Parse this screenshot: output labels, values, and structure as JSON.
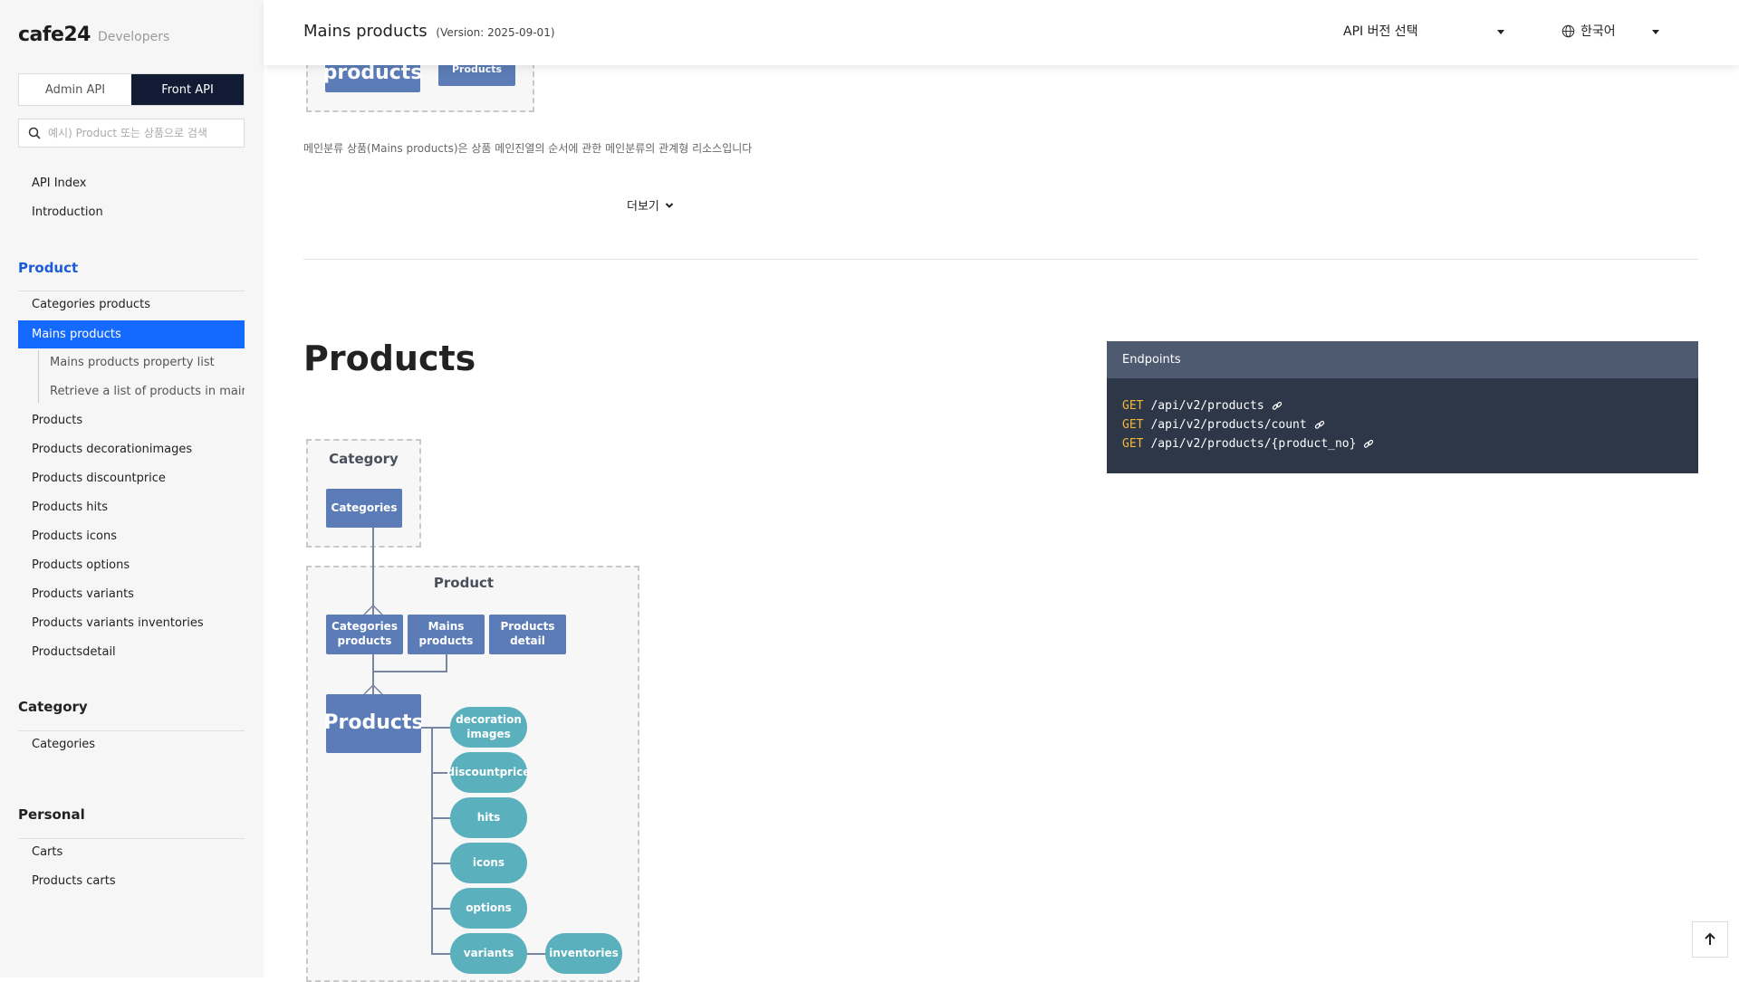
{
  "logo": {
    "brand": "cafe24",
    "sub": "Developers"
  },
  "api_tabs": [
    {
      "label": "Admin API",
      "active": false
    },
    {
      "label": "Front API",
      "active": true
    }
  ],
  "search": {
    "placeholder": "예시) Product 또는 상품으로 검색",
    "value": ""
  },
  "nav": {
    "top_links": [
      "API Index",
      "Introduction"
    ],
    "sections": [
      {
        "title": "Product",
        "items": [
          "Categories products",
          "Mains products",
          "Products",
          "Products decorationimages",
          "Products discountprice",
          "Products hits",
          "Products icons",
          "Products options",
          "Products variants",
          "Products variants inventories",
          "Productsdetail"
        ],
        "active_index": 1,
        "sub_items": [
          "Mains products property list",
          "Retrieve a list of products in main category"
        ]
      },
      {
        "title": "Category",
        "items": [
          "Categories"
        ]
      },
      {
        "title": "Personal",
        "items": [
          "Carts",
          "Products carts"
        ]
      }
    ]
  },
  "header": {
    "title": "Mains products",
    "version": "(Version: 2025-09-01)",
    "version_select": "API 버전 선택",
    "language": "한국어"
  },
  "main": {
    "description": "메인분류 상품(Mains products)은 상품 메인진열의 순서에 관한 메인분류의 관계형 리소스입니다",
    "more_label": "더보기",
    "section_title": "Products",
    "top_diagram": {
      "big_label": "products",
      "small_label": "Products"
    }
  },
  "endpoints": {
    "header": "Endpoints",
    "items": [
      {
        "method": "GET",
        "path": "/api/v2/products"
      },
      {
        "method": "GET",
        "path": "/api/v2/products/count"
      },
      {
        "method": "GET",
        "path": "/api/v2/products/{product_no}"
      }
    ]
  },
  "diagram": {
    "category_box": "Category",
    "categories": "Categories",
    "product_box": "Product",
    "categories_products": "Categories products",
    "mains_products": "Mains products",
    "products_detail": "Products detail",
    "products": "Products",
    "children": [
      "decoration images",
      "discountprice",
      "hits",
      "icons",
      "options",
      "variants"
    ],
    "grandchild": "inventories"
  },
  "colors": {
    "active_nav": "#1469ff",
    "section_blue": "#1a5bd6",
    "active_tab": "#111b33",
    "resource_box": "#5b7cb6",
    "resource_pill": "#5ab0bc",
    "endpoints_bg": "#2d3748",
    "endpoints_head": "#4e5a70",
    "http_method": "#f3b73b"
  },
  "icons": {
    "search": "search-icon",
    "globe": "globe-icon",
    "chevron": "chevron-down-icon",
    "link": "link-icon",
    "arrow_up": "arrow-up-icon"
  }
}
